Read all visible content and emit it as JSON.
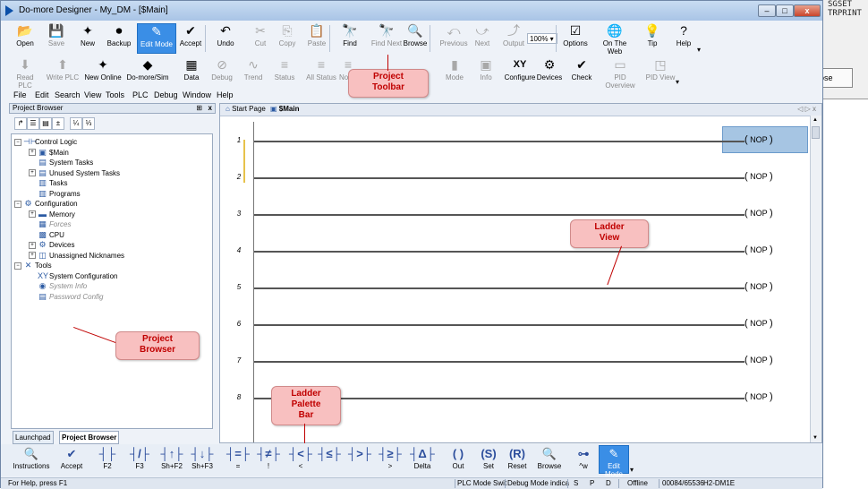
{
  "background_window": {
    "lines": [
      "SGSET",
      "TRPRINT"
    ],
    "close_label": "ose"
  },
  "window": {
    "title": "Do-more Designer - My_DM - [$Main]",
    "min_label": "–",
    "max_label": "□",
    "close_label": "x"
  },
  "toolbar1": [
    {
      "label": "Open",
      "icon": "folder-open-icon",
      "glyph": "📂",
      "enabled": true
    },
    {
      "label": "Save",
      "icon": "save-icon",
      "glyph": "💾",
      "enabled": false
    },
    {
      "label": "New",
      "icon": "new-project-icon",
      "glyph": "✦",
      "enabled": true
    },
    {
      "label": "Backup",
      "icon": "backup-icon",
      "glyph": "⏺",
      "enabled": true
    },
    {
      "label": "Edit Mode",
      "icon": "edit-mode-icon",
      "glyph": "✎",
      "enabled": true,
      "active": true
    },
    {
      "label": "Accept",
      "icon": "accept-icon",
      "glyph": "✔",
      "enabled": true
    },
    {
      "label": "Undo",
      "icon": "undo-icon",
      "glyph": "↶",
      "enabled": true
    },
    {
      "label": "Cut",
      "icon": "cut-icon",
      "glyph": "✂",
      "enabled": false
    },
    {
      "label": "Copy",
      "icon": "copy-icon",
      "glyph": "⎘",
      "enabled": false
    },
    {
      "label": "Paste",
      "icon": "paste-icon",
      "glyph": "📋",
      "enabled": false
    },
    {
      "label": "Find",
      "icon": "find-icon",
      "glyph": "🔭",
      "enabled": true
    },
    {
      "label": "Find Next",
      "icon": "find-next-icon",
      "glyph": "🔭",
      "enabled": false
    },
    {
      "label": "Browse",
      "icon": "browse-icon",
      "glyph": "🔍",
      "enabled": true
    },
    {
      "label": "Previous",
      "icon": "previous-icon",
      "glyph": "⤺",
      "enabled": false
    },
    {
      "label": "Next",
      "icon": "next-icon",
      "glyph": "⤻",
      "enabled": false
    },
    {
      "label": "Output",
      "icon": "output-icon",
      "glyph": "⤴",
      "enabled": false
    },
    {
      "label": "Options",
      "icon": "options-icon",
      "glyph": "☑",
      "enabled": true
    },
    {
      "label": "On The Web",
      "icon": "globe-icon",
      "glyph": "🌐",
      "enabled": true
    },
    {
      "label": "Tip",
      "icon": "lightbulb-icon",
      "glyph": "💡",
      "enabled": true
    },
    {
      "label": "Help",
      "icon": "help-icon",
      "glyph": "?",
      "enabled": true
    }
  ],
  "zoom_value": "100%",
  "toolbar2": [
    {
      "label": "Read PLC",
      "icon": "read-plc-icon",
      "glyph": "⬇",
      "enabled": false
    },
    {
      "label": "Write PLC",
      "icon": "write-plc-icon",
      "glyph": "⬆",
      "enabled": false
    },
    {
      "label": "New Online",
      "icon": "new-online-icon",
      "glyph": "✦",
      "enabled": true
    },
    {
      "label": "Do-more/Sim",
      "icon": "simulator-icon",
      "glyph": "◆",
      "enabled": true
    },
    {
      "label": "Data",
      "icon": "data-view-icon",
      "glyph": "▦",
      "enabled": true
    },
    {
      "label": "Debug",
      "icon": "debug-icon",
      "glyph": "⊘",
      "enabled": false
    },
    {
      "label": "Trend",
      "icon": "trend-icon",
      "glyph": "∿",
      "enabled": false
    },
    {
      "label": "Status",
      "icon": "status-icon",
      "glyph": "≡",
      "enabled": false
    },
    {
      "label": "All Status",
      "icon": "all-status-icon",
      "glyph": "≡",
      "enabled": false
    },
    {
      "label": "No St",
      "icon": "no-status-icon",
      "glyph": "≡",
      "enabled": false
    },
    {
      "label": "Mode",
      "icon": "mode-icon",
      "glyph": "▮",
      "enabled": false
    },
    {
      "label": "Info",
      "icon": "info-icon",
      "glyph": "▣",
      "enabled": false
    },
    {
      "label": "Configure",
      "icon": "configure-icon",
      "glyph": "XY",
      "enabled": true
    },
    {
      "label": "Devices",
      "icon": "devices-icon",
      "glyph": "⚙",
      "enabled": true
    },
    {
      "label": "Check",
      "icon": "check-icon",
      "glyph": "✔",
      "enabled": true
    },
    {
      "label": "PID Overview",
      "icon": "pid-overview-icon",
      "glyph": "▭",
      "enabled": false
    },
    {
      "label": "PID View",
      "icon": "pid-view-icon",
      "glyph": "◳",
      "enabled": false
    }
  ],
  "menu": [
    "File",
    "Edit",
    "Search",
    "View",
    "Tools",
    "PLC",
    "Debug",
    "Window",
    "Help"
  ],
  "project_browser": {
    "title": "Project Browser",
    "pin": "⊞",
    "close": "x",
    "tools": [
      "↱",
      "☰",
      "▤",
      "±",
      "¼",
      "⅓"
    ],
    "tree": [
      {
        "label": "Control Logic",
        "level": 0,
        "expander": "−",
        "icon": "control-logic-icon",
        "glyph": "⊣⊢"
      },
      {
        "label": "$Main",
        "level": 1,
        "expander": "+",
        "icon": "main-program-icon",
        "glyph": "▣"
      },
      {
        "label": "System Tasks",
        "level": 1,
        "expander": "",
        "icon": "system-tasks-icon",
        "glyph": "▤"
      },
      {
        "label": "Unused System Tasks",
        "level": 1,
        "expander": "+",
        "icon": "unused-tasks-icon",
        "glyph": "▤"
      },
      {
        "label": "Tasks",
        "level": 1,
        "expander": "",
        "icon": "tasks-icon",
        "glyph": "▥"
      },
      {
        "label": "Programs",
        "level": 1,
        "expander": "",
        "icon": "programs-icon",
        "glyph": "▥"
      },
      {
        "label": "Configuration",
        "level": 0,
        "expander": "−",
        "icon": "configuration-icon",
        "glyph": "⚙"
      },
      {
        "label": "Memory",
        "level": 1,
        "expander": "+",
        "icon": "memory-icon",
        "glyph": "▬"
      },
      {
        "label": "Forces",
        "level": 1,
        "expander": "",
        "icon": "forces-icon",
        "glyph": "▦",
        "disabled": true
      },
      {
        "label": "CPU",
        "level": 1,
        "expander": "",
        "icon": "cpu-icon",
        "glyph": "▩"
      },
      {
        "label": "Devices",
        "level": 1,
        "expander": "+",
        "icon": "devices-tree-icon",
        "glyph": "⚙"
      },
      {
        "label": "Unassigned Nicknames",
        "level": 1,
        "expander": "+",
        "icon": "nicknames-icon",
        "glyph": "◫"
      },
      {
        "label": "Tools",
        "level": 0,
        "expander": "−",
        "icon": "tools-icon",
        "glyph": "✕"
      },
      {
        "label": "System Configuration",
        "level": 1,
        "expander": "",
        "icon": "system-config-icon",
        "glyph": "XY"
      },
      {
        "label": "System Info",
        "level": 1,
        "expander": "",
        "icon": "system-info-icon",
        "glyph": "◉",
        "disabled": true
      },
      {
        "label": "Password Config",
        "level": 1,
        "expander": "",
        "icon": "password-icon",
        "glyph": "▤",
        "disabled": true
      }
    ],
    "tabs": [
      {
        "label": "Launchpad",
        "selected": false
      },
      {
        "label": "Project Browser",
        "selected": true
      }
    ]
  },
  "ladder_view": {
    "tabs": [
      {
        "label": "Start Page",
        "icon": "home-icon",
        "selected": false
      },
      {
        "label": "$Main",
        "icon": "main-program-icon",
        "selected": true
      }
    ],
    "nav": "◁ ▷ x",
    "rungs": [
      {
        "number": "1",
        "coil": "NOP",
        "selected": true
      },
      {
        "number": "2",
        "coil": "NOP"
      },
      {
        "number": "3",
        "coil": "NOP"
      },
      {
        "number": "4",
        "coil": "NOP"
      },
      {
        "number": "5",
        "coil": "NOP"
      },
      {
        "number": "6",
        "coil": "NOP"
      },
      {
        "number": "7",
        "coil": "NOP"
      },
      {
        "number": "8",
        "coil": "NOP"
      }
    ]
  },
  "palette": [
    {
      "label": "Instructions",
      "icon": "instructions-icon",
      "glyph": "🔍"
    },
    {
      "label": "Accept",
      "icon": "accept-icon",
      "glyph": "✔"
    },
    {
      "label": "F2",
      "icon": "no-contact-icon",
      "glyph": "┤├"
    },
    {
      "label": "F3",
      "icon": "nc-contact-icon",
      "glyph": "┤/├"
    },
    {
      "label": "Sh+F2",
      "icon": "rising-edge-contact-icon",
      "glyph": "┤↑├"
    },
    {
      "label": "Sh+F3",
      "icon": "falling-edge-contact-icon",
      "glyph": "┤↓├"
    },
    {
      "label": "=",
      "icon": "equal-compare-icon",
      "glyph": "┤=├"
    },
    {
      "label": "!",
      "icon": "not-equal-compare-icon",
      "glyph": "┤≠├"
    },
    {
      "label": "<",
      "icon": "less-compare-icon",
      "glyph": "┤<├"
    },
    {
      "label": "",
      "icon": "less-equal-compare-icon",
      "glyph": "┤≤├"
    },
    {
      "label": "",
      "icon": "greater-compare-icon",
      "glyph": "┤>├"
    },
    {
      "label": ">",
      "icon": "greater-equal-compare-icon",
      "glyph": "┤≥├"
    },
    {
      "label": "Delta",
      "icon": "delta-icon",
      "glyph": "┤Δ├"
    },
    {
      "label": "Out",
      "icon": "out-coil-icon",
      "glyph": "( )"
    },
    {
      "label": "Set",
      "icon": "set-coil-icon",
      "glyph": "(S)"
    },
    {
      "label": "Reset",
      "icon": "reset-coil-icon",
      "glyph": "(R)"
    },
    {
      "label": "Browse",
      "icon": "browse-icon",
      "glyph": "🔍"
    },
    {
      "label": "^w",
      "icon": "wire-icon",
      "glyph": "⊶"
    },
    {
      "label": "Edit Mode",
      "icon": "edit-mode-icon",
      "glyph": "✎",
      "active": true
    }
  ],
  "status": {
    "help": "For Help, press F1",
    "plc_mode": "PLC Mode Swit",
    "debug_mode": "Debug Mode indica",
    "s": "S",
    "p": "P",
    "d": "D",
    "online": "Offline",
    "memory": "00084/65536",
    "plc": "H2-DM1E"
  },
  "callouts": {
    "toolbar": [
      "Project",
      "Toolbar"
    ],
    "ladder_view": [
      "Ladder",
      "View"
    ],
    "project_browser": [
      "Project",
      "Browser"
    ],
    "palette": [
      "Ladder",
      "Palette",
      "Bar"
    ]
  }
}
